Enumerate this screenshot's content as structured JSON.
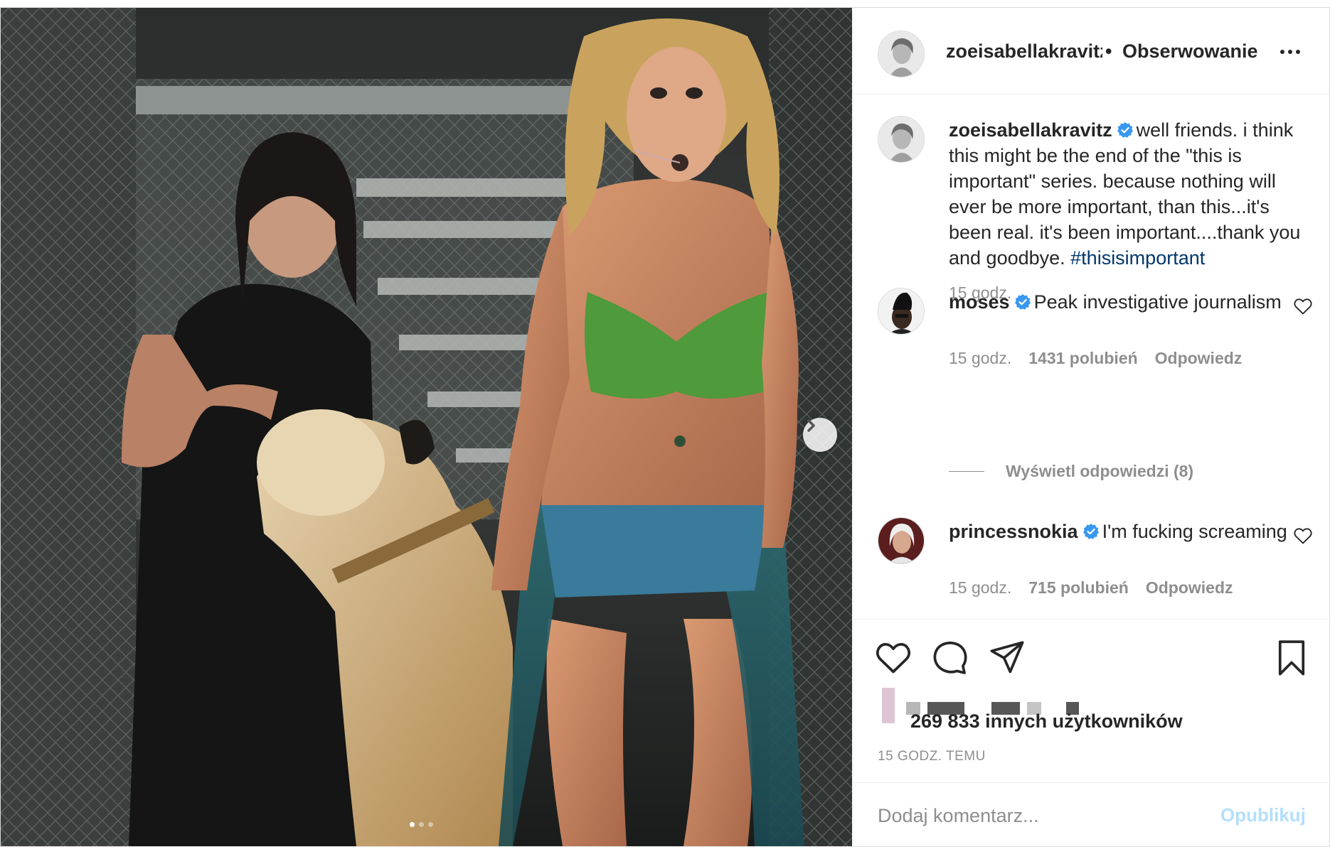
{
  "header": {
    "username": "zoeisabellakravitz",
    "separator": "•",
    "follow_label": "Obserwowanie",
    "avatar_icon": "profile-avatar"
  },
  "caption": {
    "username": "zoeisabellakravitz",
    "text": "well friends. i think this might be the end of the \"this is important\" series. because nothing will ever be more important, than this...it's been real. it's been important....thank you and goodbye. ",
    "hashtag": "#thisisimportant",
    "time": "15 godz."
  },
  "comments": [
    {
      "username": "moses",
      "text": "Peak investigative journalism",
      "time": "15 godz.",
      "likes": "1431 polubień",
      "reply_label": "Odpowiedz"
    },
    {
      "username": "princessnokia",
      "text": "I'm fucking screaming",
      "time": "15 godz.",
      "likes": "715 polubień",
      "reply_label": "Odpowiedz"
    }
  ],
  "view_replies": "Wyświetl odpowiedzi (8)",
  "actions": {
    "likes_count": "269 833 innych użytkowników",
    "timestamp": "15 GODZ. TEMU"
  },
  "add_comment": {
    "placeholder": "Dodaj komentarz...",
    "publish_label": "Opublikuj"
  },
  "colors": {
    "text": "#262626",
    "muted": "#8e8e8e",
    "hashtag": "#00376b",
    "verified": "#3897f0",
    "publish_disabled": "#b2dffc"
  },
  "carousel": {
    "total": 3,
    "active": 1
  }
}
